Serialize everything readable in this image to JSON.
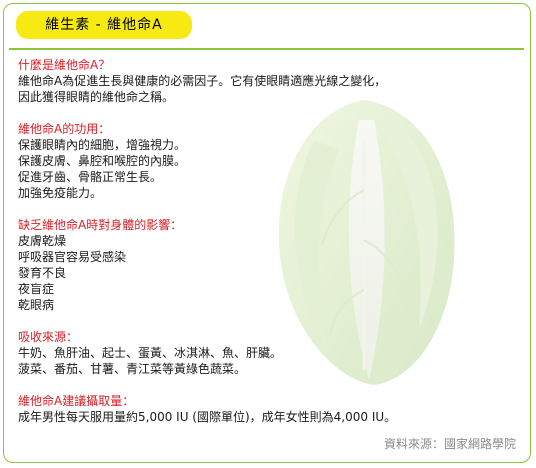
{
  "title": "維生素 - 維他命A",
  "sections": [
    {
      "heading": "什麼是維他命A？",
      "lines": [
        "維他命A為促進生長與健康的必需因子。它有使眼睛適應光線之變化，",
        "因此獲得眼睛的維他命之稱。"
      ]
    },
    {
      "heading": "維他命A的功用：",
      "lines": [
        "保護眼睛內的細胞，增強視力。",
        "保護皮膚、鼻腔和喉腔的內膜。",
        "促進牙齒、骨骼正常生長。",
        "加強免疫能力。"
      ]
    },
    {
      "heading": "缺乏維他命A時對身體的影響：",
      "lines": [
        "皮膚乾燥",
        "呼吸器官容易受感染",
        "發育不良",
        "夜盲症",
        "乾眼病"
      ]
    },
    {
      "heading": "吸收來源：",
      "lines": [
        "牛奶、魚肝油、起士、蛋黃、冰淇淋、魚、肝臟。",
        "菠菜、番茄、甘薯、青江菜等黃綠色蔬菜。"
      ]
    },
    {
      "heading": "維他命A建議攝取量：",
      "lines": [
        "成年男性每天服用量約5,000 IU (國際單位)，成年女性則為4,000 IU。"
      ]
    }
  ],
  "source": "資料來源：國家網路學院",
  "colors": {
    "accent_green": "#8cc43c",
    "title_yellow": "#f6ea12",
    "heading_red": "#d8212a",
    "source_gray": "#8a8a8a"
  },
  "decoration": "watermark-cabbage-illustration"
}
